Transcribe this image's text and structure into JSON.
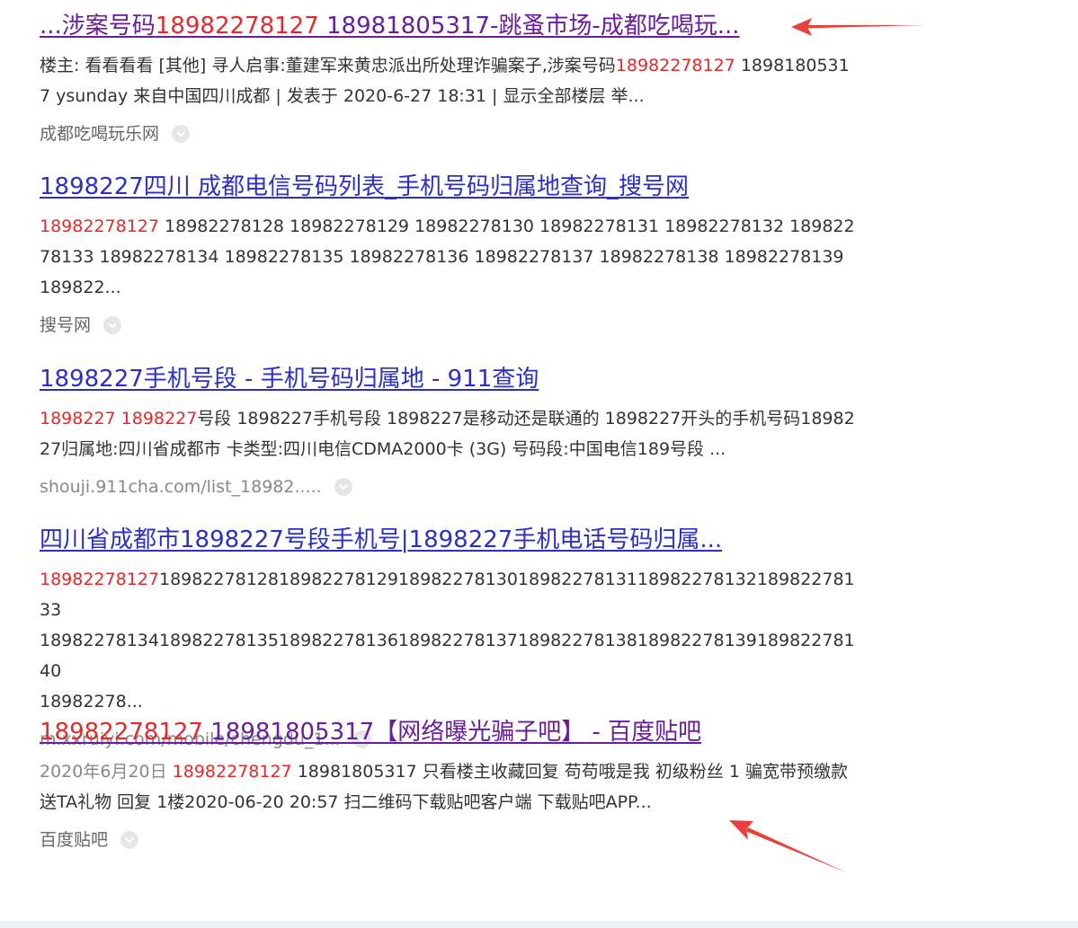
{
  "colors": {
    "title_blue": "#2b2fc7",
    "title_visited_purple": "#6a1d9a",
    "highlight_red": "#e32a2a",
    "arrow_red": "#e8413b"
  },
  "results": [
    {
      "title_prefix": "...涉案号码",
      "title_hl": "18982278127",
      "title_suffix": " 18981805317-跳蚤市场-成都吃喝玩...",
      "abs_line1_a": "楼主: 看看看看 [其他] 寻人启事:董建军来黄忠派出所处理诈骗案子,涉案号码",
      "abs_line1_hl": "18982278127",
      "abs_line1_b": " 18981805317 ysunday 来自中国四川成都 | 发表于 2020-6-27 18:31 | 显示全部楼层 举...",
      "source": "成都吃喝玩乐网"
    },
    {
      "title": "1898227四川 成都电信号码列表_手机号码归属地查询_搜号网",
      "abs_hl": "18982278127",
      "abs_rest": " 18982278128 18982278129 18982278130 18982278131 18982278132 18982278133 18982278134 18982278135 18982278136 18982278137 18982278138 18982278139 189822...",
      "source": "搜号网"
    },
    {
      "title": "1898227手机号段 - 手机号码归属地 - 911查询",
      "abs_hl": "1898227 1898227",
      "abs_rest": "号段 1898227手机号段 1898227是移动还是联通的 1898227开头的手机号码1898227归属地:四川省成都市 卡类型:四川电信CDMA2000卡 (3G) 号码段:中国电信189号段 ...",
      "source": "shouji.911cha.com/list_18982....."
    },
    {
      "title": "四川省成都市1898227号段手机号|1898227手机电话号码归属...",
      "abs_hl": "18982278127",
      "abs_line1_rest": "1898227812818982278129189822781301898227813118982278132189822781 33",
      "abs_line2": "18982278134189822781351898227813618982278137189822781381898227813918982278140",
      "abs_line3": "18982278...",
      "source": "m.xxruiyi.com/mobile/chengdu_1..."
    },
    {
      "title_hl": "18982278127",
      "title_rest": " 18981805317【网络曝光骗子吧】 - 百度贴吧",
      "date": "2020年6月20日",
      "abs_hl": "18982278127",
      "abs_rest": " 18981805317 只看楼主收藏回复 苟苟哦是我 初级粉丝 1 骗宽带预缴款 送TA礼物 回复 1楼2020-06-20 20:57 扫二维码下载贴吧客户端 下载贴吧APP...",
      "source": "百度贴吧"
    }
  ]
}
